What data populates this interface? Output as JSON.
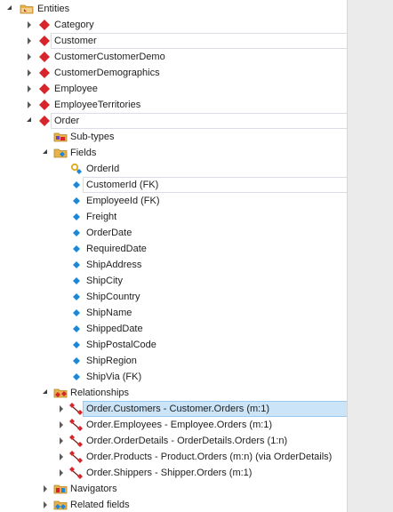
{
  "tree": {
    "root": {
      "label": "Entities",
      "icon": "entities-folder-icon"
    },
    "entities": [
      {
        "label": "Category"
      },
      {
        "label": "Customer"
      },
      {
        "label": "CustomerCustomerDemo"
      },
      {
        "label": "CustomerDemographics"
      },
      {
        "label": "Employee"
      },
      {
        "label": "EmployeeTerritories"
      },
      {
        "label": "Order"
      }
    ],
    "order": {
      "subtypes_label": "Sub-types",
      "fields_label": "Fields",
      "fields": [
        "OrderId",
        "CustomerId (FK)",
        "EmployeeId (FK)",
        "Freight",
        "OrderDate",
        "RequiredDate",
        "ShipAddress",
        "ShipCity",
        "ShipCountry",
        "ShipName",
        "ShippedDate",
        "ShipPostalCode",
        "ShipRegion",
        "ShipVia (FK)"
      ],
      "relationships_label": "Relationships",
      "relationships": [
        "Order.Customers - Customer.Orders (m:1)",
        "Order.Employees - Employee.Orders (m:1)",
        "Order.OrderDetails - OrderDetails.Orders (1:n)",
        "Order.Products - Product.Orders (m:n) (via OrderDetails)",
        "Order.Shippers - Shipper.Orders (m:1)"
      ],
      "navigators_label": "Navigators",
      "related_fields_label": "Related fields"
    }
  },
  "colors": {
    "entity_icon": "#d7262b",
    "field_icon": "#1e88d8",
    "pk_icon": "#e0a91a",
    "selection_bg": "#cce4f7",
    "selection_border": "#99c9ef",
    "right_panel": "#ebebeb"
  }
}
